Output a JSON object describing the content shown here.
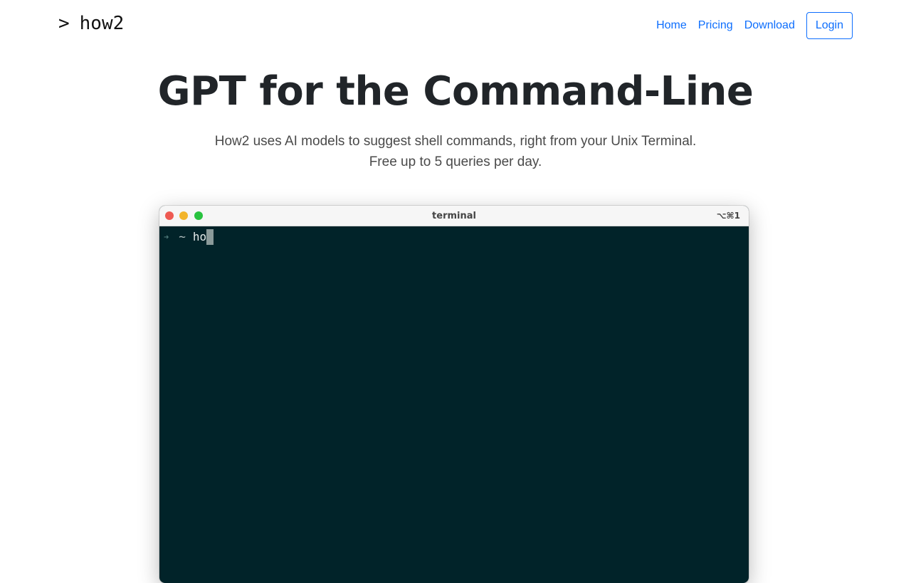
{
  "nav": {
    "brand_prompt": ">",
    "brand_name": "how2",
    "links": [
      "Home",
      "Pricing",
      "Download"
    ],
    "login_label": "Login"
  },
  "hero": {
    "title": "GPT for the Command-Line",
    "subtitle_line1": "How2 uses AI models to suggest shell commands, right from your Unix Terminal.",
    "subtitle_line2": "Free up to 5 queries per day."
  },
  "terminal": {
    "title": "terminal",
    "shortcut": "⌥⌘1",
    "prompt_arrow": "➜",
    "prompt_dir": "~",
    "typed_command": "ho"
  },
  "colors": {
    "accent": "#0d6efd",
    "terminal_bg": "#012329",
    "traffic_red": "#ee5a52",
    "traffic_yellow": "#f2b42b",
    "traffic_green": "#28c23f"
  }
}
